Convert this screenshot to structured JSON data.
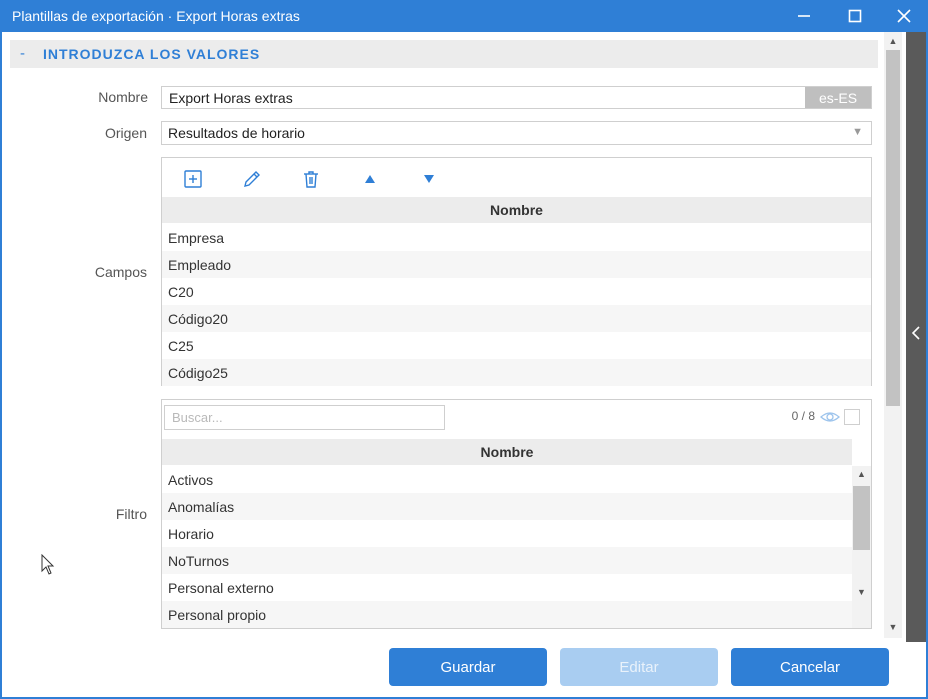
{
  "window": {
    "title": "Plantillas de exportación · Export Horas extras",
    "controls": [
      "minimize-icon",
      "maximize-icon",
      "close-icon"
    ]
  },
  "section": {
    "toggle": "-",
    "title": "INTRODUZCA LOS VALORES"
  },
  "form": {
    "nombre_label": "Nombre",
    "nombre_value": "Export Horas extras",
    "nombre_lang": "es-ES",
    "origen_label": "Origen",
    "origen_value": "Resultados de horario",
    "campos_label": "Campos",
    "filtro_label": "Filtro"
  },
  "campos": {
    "toolbar": [
      "add-icon",
      "edit-icon",
      "delete-icon",
      "move-up-icon",
      "move-down-icon"
    ],
    "column_header": "Nombre",
    "rows": [
      "Empresa",
      "Empleado",
      "C20",
      "Código20",
      "C25",
      "Código25"
    ]
  },
  "filtro": {
    "search_placeholder": "Buscar...",
    "counter": "0 / 8",
    "column_header": "Nombre",
    "rows": [
      "Activos",
      "Anomalías",
      "Horario",
      "NoTurnos",
      "Personal externo",
      "Personal propio"
    ]
  },
  "buttons": {
    "guardar": "Guardar",
    "editar": "Editar",
    "cancelar": "Cancelar"
  },
  "colors": {
    "accent": "#2f7fd6",
    "disabled_button": "#a9cdf1",
    "header_bg": "#ececec",
    "side_strip": "#5a5a5a"
  }
}
